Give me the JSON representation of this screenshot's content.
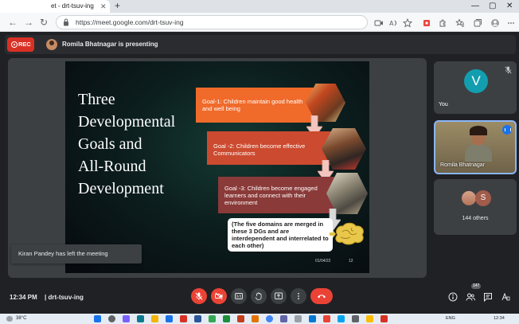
{
  "browser": {
    "tab_title": "et - drt-tsuv-ing",
    "address_url": "https://meet.google.com/drt-tsuv-ing"
  },
  "meet": {
    "rec_label": "REC",
    "presenting_text": "Romila Bhatnagar is presenting",
    "toast_text": "Kiran Pandey has left the meeting",
    "time": "12:34 PM",
    "separator": "|",
    "meeting_code": "drt-tsuv-ing",
    "participant_badge": "147"
  },
  "slide": {
    "title_lines": [
      "Three",
      "Developmental",
      "Goals and",
      "All-Round",
      "Development"
    ],
    "goals": [
      {
        "text": "Goal-1: Children maintain good health and well being"
      },
      {
        "text": "Goal -2: Children become effective Communicators"
      },
      {
        "text": "Goal -3: Children become engaged learners and connect with their environment"
      }
    ],
    "note": "(The five domains are merged in these 3 DGs and are interdependent and interrelated to each other)",
    "date": "01/04/22",
    "page": "12"
  },
  "participants": {
    "you": {
      "initial": "V",
      "label": "You"
    },
    "presenter": {
      "label": "Romila Bhatnagar"
    },
    "others": {
      "initial": "S",
      "label": "144 others"
    }
  },
  "taskbar": {
    "weather": "38°C",
    "lang": "ENG",
    "clock": "12:34"
  },
  "colors": {
    "rec_red": "#d93025",
    "end_call_red": "#ea4335",
    "goal1": "#f06a2a",
    "goal2": "#cc4a2f",
    "goal3": "#8a3a38",
    "you_avatar": "#129eaf",
    "active_speaker": "#8ab4f8"
  }
}
